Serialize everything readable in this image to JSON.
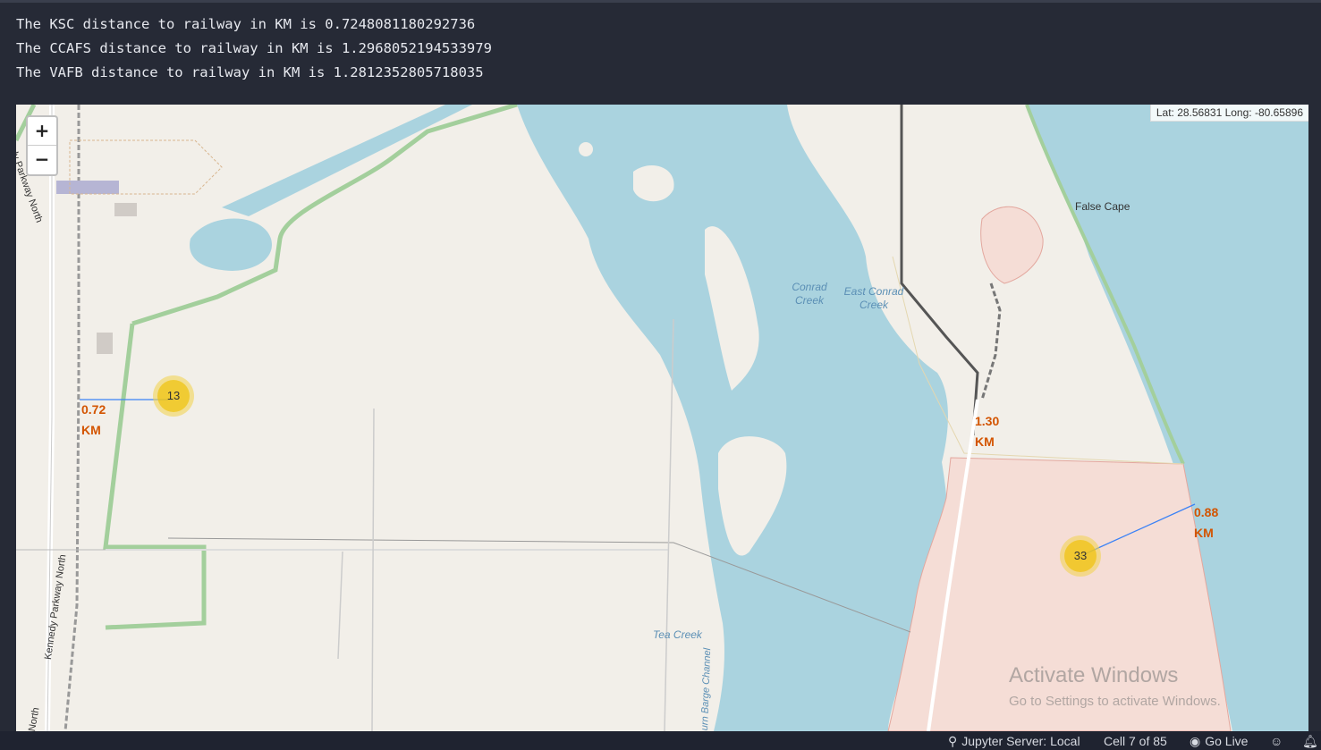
{
  "output_lines": [
    "The KSC distance to railway in KM is 0.7248081180292736",
    "The CCAFS distance to railway in KM is 1.2968052194533979",
    "The VAFB distance to railway in KM is 1.2812352805718035"
  ],
  "map": {
    "zoom_in_label": "+",
    "zoom_out_label": "−",
    "mouse_position": "Lat: 28.56831 Long: -80.65896",
    "clusters": [
      {
        "count": "13"
      },
      {
        "count": "33"
      }
    ],
    "distance_labels": [
      {
        "value": "0.72",
        "unit": "KM"
      },
      {
        "value": "1.30",
        "unit": "KM"
      },
      {
        "value": "0.88",
        "unit": "KM"
      }
    ],
    "place_labels": {
      "false_cape": "False Cape",
      "conrad_creek_1": "Conrad",
      "conrad_creek_2": "Creek",
      "east_conrad_1": "East Conrad",
      "east_conrad_2": "Creek",
      "tea_creek": "Tea Creek",
      "barge_channel": "urn Barge Channel",
      "kennedy_parkway_north": "Kennedy Parkway North",
      "parkway_north_top": "dy Parkway North",
      "north": "North"
    },
    "watermark": {
      "title": "Activate Windows",
      "subtitle": "Go to Settings to activate Windows."
    }
  },
  "statusbar": {
    "jupyter_server": "Jupyter Server: Local",
    "cell_position": "Cell 7 of 85",
    "go_live": "Go Live"
  }
}
